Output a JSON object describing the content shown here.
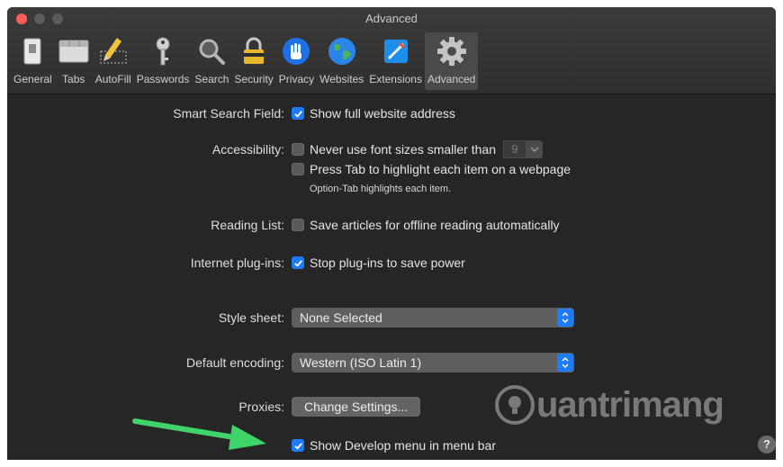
{
  "window": {
    "title": "Advanced"
  },
  "toolbar": {
    "items": [
      {
        "label": "General",
        "icon": "general-switch-icon"
      },
      {
        "label": "Tabs",
        "icon": "tabs-icon"
      },
      {
        "label": "AutoFill",
        "icon": "autofill-pencil-icon"
      },
      {
        "label": "Passwords",
        "icon": "key-icon"
      },
      {
        "label": "Search",
        "icon": "magnifier-icon"
      },
      {
        "label": "Security",
        "icon": "padlock-icon"
      },
      {
        "label": "Privacy",
        "icon": "hand-icon"
      },
      {
        "label": "Websites",
        "icon": "globe-icon"
      },
      {
        "label": "Extensions",
        "icon": "puzzle-icon"
      },
      {
        "label": "Advanced",
        "icon": "gear-icon",
        "selected": true
      }
    ]
  },
  "settings": {
    "smart_search": {
      "label": "Smart Search Field:",
      "option": "Show full website address",
      "checked": true
    },
    "accessibility": {
      "label": "Accessibility:",
      "font_option": "Never use font sizes smaller than",
      "font_checked": false,
      "font_size": "9",
      "tab_option": "Press Tab to highlight each item on a webpage",
      "tab_checked": false,
      "tab_note": "Option-Tab highlights each item."
    },
    "reading_list": {
      "label": "Reading List:",
      "option": "Save articles for offline reading automatically",
      "checked": false
    },
    "plugins": {
      "label": "Internet plug-ins:",
      "option": "Stop plug-ins to save power",
      "checked": true
    },
    "style_sheet": {
      "label": "Style sheet:",
      "value": "None Selected"
    },
    "encoding": {
      "label": "Default encoding:",
      "value": "Western (ISO Latin 1)"
    },
    "proxies": {
      "label": "Proxies:",
      "button": "Change Settings..."
    },
    "develop": {
      "option": "Show Develop menu in menu bar",
      "checked": true
    }
  },
  "help": {
    "label": "?"
  },
  "watermark": {
    "text": "uantrimang"
  },
  "colors": {
    "accent": "#1d7bff",
    "background": "#262626",
    "arrow": "#3fd46a"
  }
}
